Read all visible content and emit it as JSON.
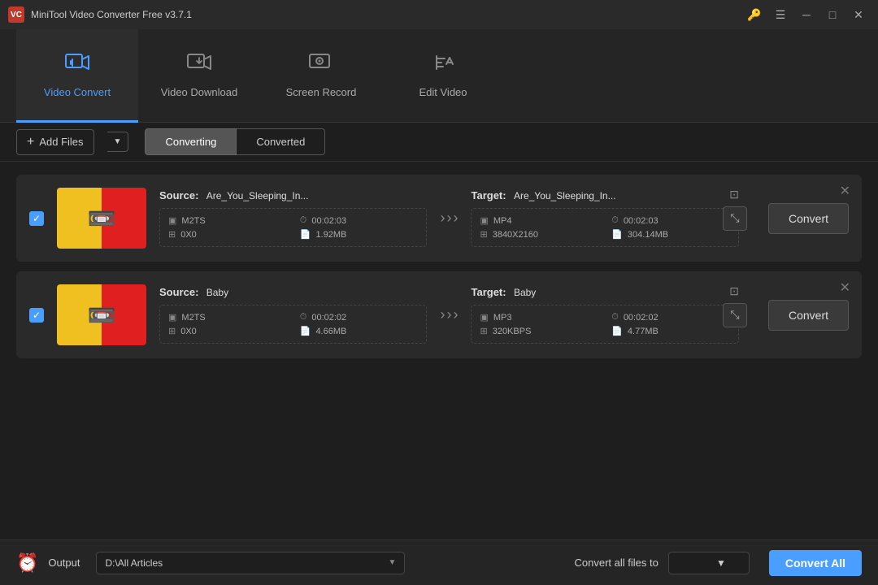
{
  "app": {
    "title": "MiniTool Video Converter Free v3.7.1",
    "icon_label": "VC"
  },
  "titlebar": {
    "controls": {
      "key_btn": "🔑",
      "menu_btn": "☰",
      "minimize_btn": "─",
      "maximize_btn": "□",
      "close_btn": "✕"
    }
  },
  "nav": {
    "tabs": [
      {
        "id": "video-convert",
        "label": "Video Convert",
        "active": true
      },
      {
        "id": "video-download",
        "label": "Video Download",
        "active": false
      },
      {
        "id": "screen-record",
        "label": "Screen Record",
        "active": false
      },
      {
        "id": "edit-video",
        "label": "Edit Video",
        "active": false
      }
    ]
  },
  "subtabs": {
    "add_files_label": "Add Files",
    "tabs": [
      {
        "id": "converting",
        "label": "Converting",
        "active": true
      },
      {
        "id": "converted",
        "label": "Converted",
        "active": false
      }
    ]
  },
  "files": [
    {
      "id": "file1",
      "checked": true,
      "source": {
        "label": "Source:",
        "name": "Are_You_Sleeping_In...",
        "format": "M2TS",
        "duration": "00:02:03",
        "resolution": "0X0",
        "size": "1.92MB"
      },
      "target": {
        "label": "Target:",
        "name": "Are_You_Sleeping_In...",
        "format": "MP4",
        "duration": "00:02:03",
        "resolution": "3840X2160",
        "size": "304.14MB"
      },
      "convert_label": "Convert"
    },
    {
      "id": "file2",
      "checked": true,
      "source": {
        "label": "Source:",
        "name": "Baby",
        "format": "M2TS",
        "duration": "00:02:02",
        "resolution": "0X0",
        "size": "4.66MB"
      },
      "target": {
        "label": "Target:",
        "name": "Baby",
        "format": "MP3",
        "duration": "00:02:02",
        "resolution": "320KBPS",
        "size": "4.77MB"
      },
      "convert_label": "Convert"
    }
  ],
  "bottom": {
    "output_icon": "⏰",
    "output_label": "Output",
    "output_path": "D:\\All Articles",
    "convert_all_files_label": "Convert all files to",
    "convert_all_label": "Convert All"
  }
}
